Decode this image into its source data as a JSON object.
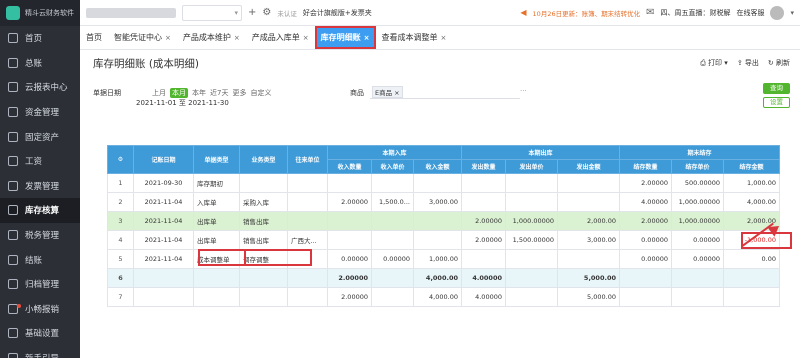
{
  "app": {
    "logo_text": "精斗云财务软件"
  },
  "sidebar": {
    "items": [
      {
        "label": "首页",
        "icon": "home-icon"
      },
      {
        "label": "总账",
        "icon": "ledger-icon"
      },
      {
        "label": "云报表中心",
        "icon": "report-icon"
      },
      {
        "label": "资金管理",
        "icon": "fund-icon"
      },
      {
        "label": "固定资产",
        "icon": "asset-icon"
      },
      {
        "label": "工资",
        "icon": "salary-icon"
      },
      {
        "label": "发票管理",
        "icon": "invoice-icon"
      },
      {
        "label": "库存核算",
        "icon": "inventory-icon",
        "active": true
      },
      {
        "label": "税务管理",
        "icon": "tax-icon"
      },
      {
        "label": "结账",
        "icon": "close-icon"
      },
      {
        "label": "归档管理",
        "icon": "archive-icon"
      },
      {
        "label": "小畅报销",
        "icon": "expense-icon"
      },
      {
        "label": "基础设置",
        "icon": "settings-icon"
      },
      {
        "label": "新手引导",
        "icon": "guide-icon"
      }
    ]
  },
  "topbar": {
    "unverified": "未认证",
    "promo": "好会计旗舰版+发票夹",
    "notice": "10月26日更新：账簿、期末结转优化",
    "live": "四、周五直播：财税解",
    "service": "在线客服"
  },
  "tabs": [
    {
      "label": "首页",
      "closable": false
    },
    {
      "label": "智能凭证中心",
      "closable": true
    },
    {
      "label": "产品成本维护",
      "closable": true
    },
    {
      "label": "产成品入库单",
      "closable": true
    },
    {
      "label": "库存明细账",
      "closable": true,
      "active": true
    },
    {
      "label": "查看成本调整单",
      "closable": true
    }
  ],
  "page": {
    "title": "库存明细账 (成本明细)",
    "tools": {
      "print": "打印",
      "export": "导出",
      "refresh": "刷新"
    }
  },
  "filter": {
    "date_label": "单据日期",
    "periods": [
      "上月",
      "本月",
      "本年",
      "近7天",
      "更多",
      "自定义"
    ],
    "active_period": "本月",
    "date_range": "2021-11-01 至 2021-11-30",
    "goods_label": "商品",
    "goods_tag": "E商品",
    "query_btn": "查询",
    "settings_btn": "设置"
  },
  "table": {
    "groups": {
      "inbound": "本期入库",
      "outbound": "本期出库",
      "ending": "期末结存"
    },
    "columns": {
      "idx": "",
      "date": "记账日期",
      "doc_type": "单据类型",
      "biz_type": "业务类型",
      "partner": "往来单位",
      "in_qty": "收入数量",
      "in_price": "收入单价",
      "in_amount": "收入金额",
      "out_qty": "发出数量",
      "out_price": "发出单价",
      "out_amount": "发出金额",
      "bal_qty": "结存数量",
      "bal_price": "结存单价",
      "bal_amount": "结存金额"
    },
    "rows": [
      {
        "idx": "1",
        "date": "2021-09-30",
        "doc_type": "库存期初",
        "biz_type": "",
        "partner": "",
        "in_qty": "",
        "in_price": "",
        "in_amount": "",
        "out_qty": "",
        "out_price": "",
        "out_amount": "",
        "bal_qty": "2.00000",
        "bal_price": "500.00000",
        "bal_amount": "1,000.00",
        "style": ""
      },
      {
        "idx": "2",
        "date": "2021-11-04",
        "doc_type": "入库单",
        "biz_type": "采购入库",
        "partner": "",
        "in_qty": "2.00000",
        "in_price": "1,500.0...",
        "in_amount": "3,000.00",
        "out_qty": "",
        "out_price": "",
        "out_amount": "",
        "bal_qty": "4.00000",
        "bal_price": "1,000.00000",
        "bal_amount": "4,000.00",
        "style": ""
      },
      {
        "idx": "3",
        "date": "2021-11-04",
        "doc_type": "出库单",
        "biz_type": "销售出库",
        "partner": "",
        "in_qty": "",
        "in_price": "",
        "in_amount": "",
        "out_qty": "2.00000",
        "out_price": "1,000.00000",
        "out_amount": "2,000.00",
        "bal_qty": "2.00000",
        "bal_price": "1,000.00000",
        "bal_amount": "2,000.00",
        "style": "green"
      },
      {
        "idx": "4",
        "date": "2021-11-04",
        "doc_type": "出库单",
        "biz_type": "销售出库",
        "partner": "广西大...",
        "in_qty": "",
        "in_price": "",
        "in_amount": "",
        "out_qty": "2.00000",
        "out_price": "1,500.00000",
        "out_amount": "3,000.00",
        "bal_qty": "0.00000",
        "bal_price": "0.00000",
        "bal_amount": "-1,000.00",
        "style": ""
      },
      {
        "idx": "5",
        "date": "2021-11-04",
        "doc_type": "成本调整单",
        "biz_type": "调存调整",
        "partner": "",
        "in_qty": "0.00000",
        "in_price": "0.00000",
        "in_amount": "1,000.00",
        "out_qty": "",
        "out_price": "",
        "out_amount": "",
        "bal_qty": "0.00000",
        "bal_price": "0.00000",
        "bal_amount": "0.00",
        "style": ""
      },
      {
        "idx": "6",
        "date": "",
        "doc_type": "",
        "biz_type": "",
        "partner": "",
        "in_qty": "2.00000",
        "in_price": "",
        "in_amount": "4,000.00",
        "out_qty": "4.00000",
        "out_price": "",
        "out_amount": "5,000.00",
        "bal_qty": "",
        "bal_price": "",
        "bal_amount": "",
        "style": "sub"
      },
      {
        "idx": "7",
        "date": "",
        "doc_type": "",
        "biz_type": "",
        "partner": "",
        "in_qty": "2.00000",
        "in_price": "",
        "in_amount": "4,000.00",
        "out_qty": "4.00000",
        "out_price": "",
        "out_amount": "5,000.00",
        "bal_qty": "",
        "bal_price": "",
        "bal_amount": "",
        "style": ""
      }
    ]
  },
  "colors": {
    "accent": "#3f9bd8",
    "green": "#52b52e",
    "highlight": "#d9363e",
    "sidebar": "#2c2f36"
  }
}
